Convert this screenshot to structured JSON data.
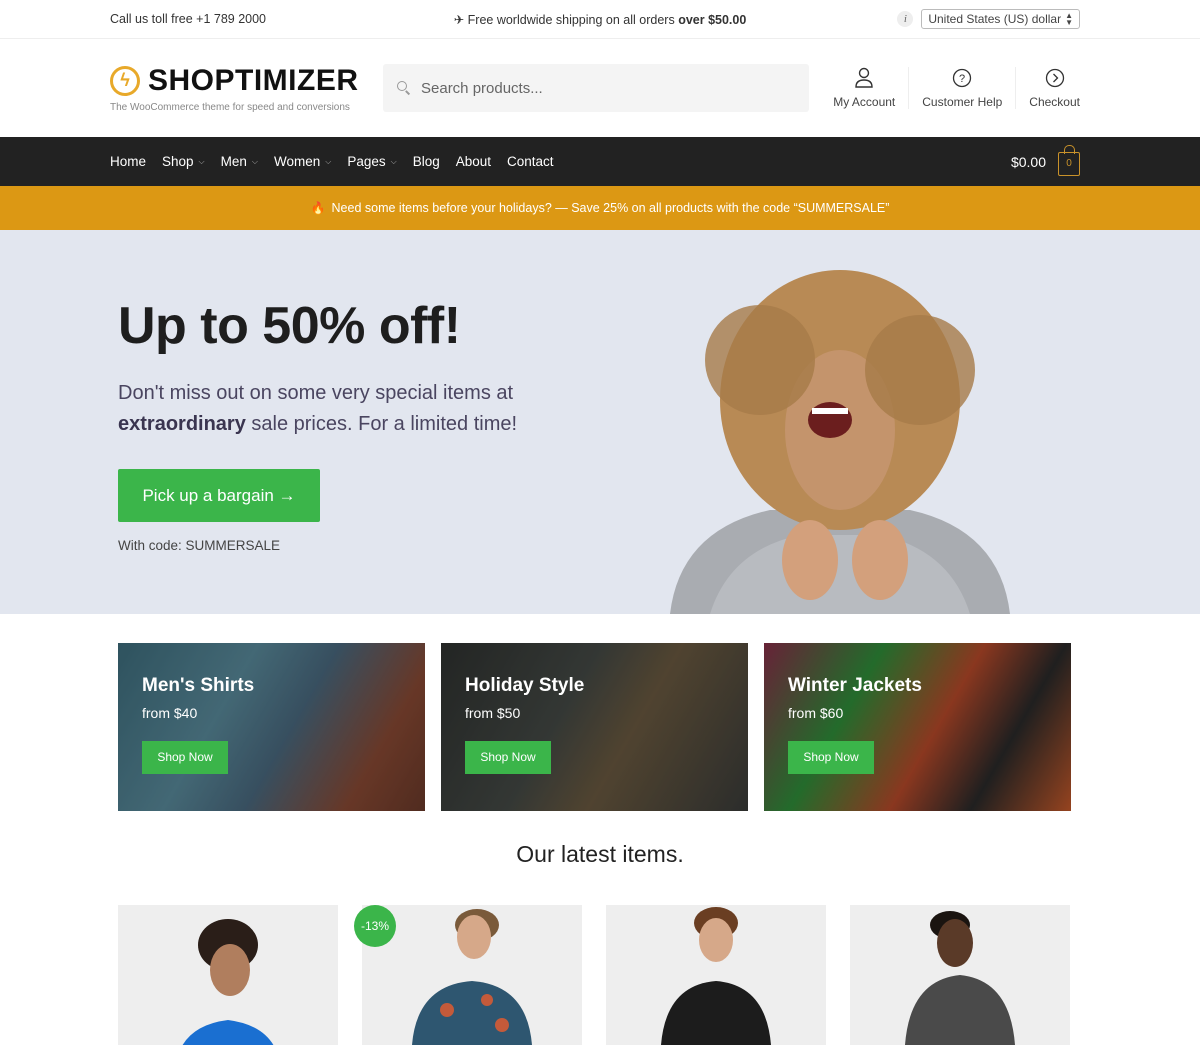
{
  "topbar": {
    "phone_text": "Call us toll free +1 789 2000",
    "shipping_prefix": "✈ Free worldwide shipping on all orders ",
    "shipping_bold": "over $50.00",
    "info_icon": "i",
    "currency": "United States (US) dollar"
  },
  "header": {
    "logo_text": "SHOPTIMIZER",
    "tagline": "The WooCommerce theme for speed and conversions",
    "search_placeholder": "Search products...",
    "links": [
      {
        "label": "My Account",
        "icon": "user-icon"
      },
      {
        "label": "Customer Help",
        "icon": "help-circle-icon"
      },
      {
        "label": "Checkout",
        "icon": "chevron-right-circle-icon"
      }
    ]
  },
  "nav": {
    "items": [
      {
        "label": "Home",
        "dropdown": false
      },
      {
        "label": "Shop",
        "dropdown": true
      },
      {
        "label": "Men",
        "dropdown": true
      },
      {
        "label": "Women",
        "dropdown": true
      },
      {
        "label": "Pages",
        "dropdown": true
      },
      {
        "label": "Blog",
        "dropdown": false
      },
      {
        "label": "About",
        "dropdown": false
      },
      {
        "label": "Contact",
        "dropdown": false
      }
    ],
    "cart_total": "$0.00",
    "cart_count": "0"
  },
  "promo": {
    "icon": "🔥",
    "text": "Need some items before your holidays? — Save 25% on all products with the code “SUMMERSALE”"
  },
  "hero": {
    "title": "Up to 50% off!",
    "text_line1": "Don't miss out on some very special items at",
    "text_bold": "extraordinary",
    "text_line2": " sale prices. For a limited time!",
    "button": "Pick up a bargain →",
    "code_text": "With code: SUMMERSALE"
  },
  "categories": [
    {
      "title": "Men's Shirts",
      "price": "from $40",
      "button": "Shop Now"
    },
    {
      "title": "Holiday Style",
      "price": "from $50",
      "button": "Shop Now"
    },
    {
      "title": "Winter Jackets",
      "price": "from $60",
      "button": "Shop Now"
    }
  ],
  "latest": {
    "title": "Our latest items.",
    "products": [
      {
        "badge": null
      },
      {
        "badge": "-13%"
      },
      {
        "badge": null
      },
      {
        "badge": null
      }
    ]
  },
  "colors": {
    "accent_green": "#3bb54a",
    "promo_orange": "#dc9814",
    "nav_dark": "#222222",
    "logo_orange": "#e8a92a"
  }
}
